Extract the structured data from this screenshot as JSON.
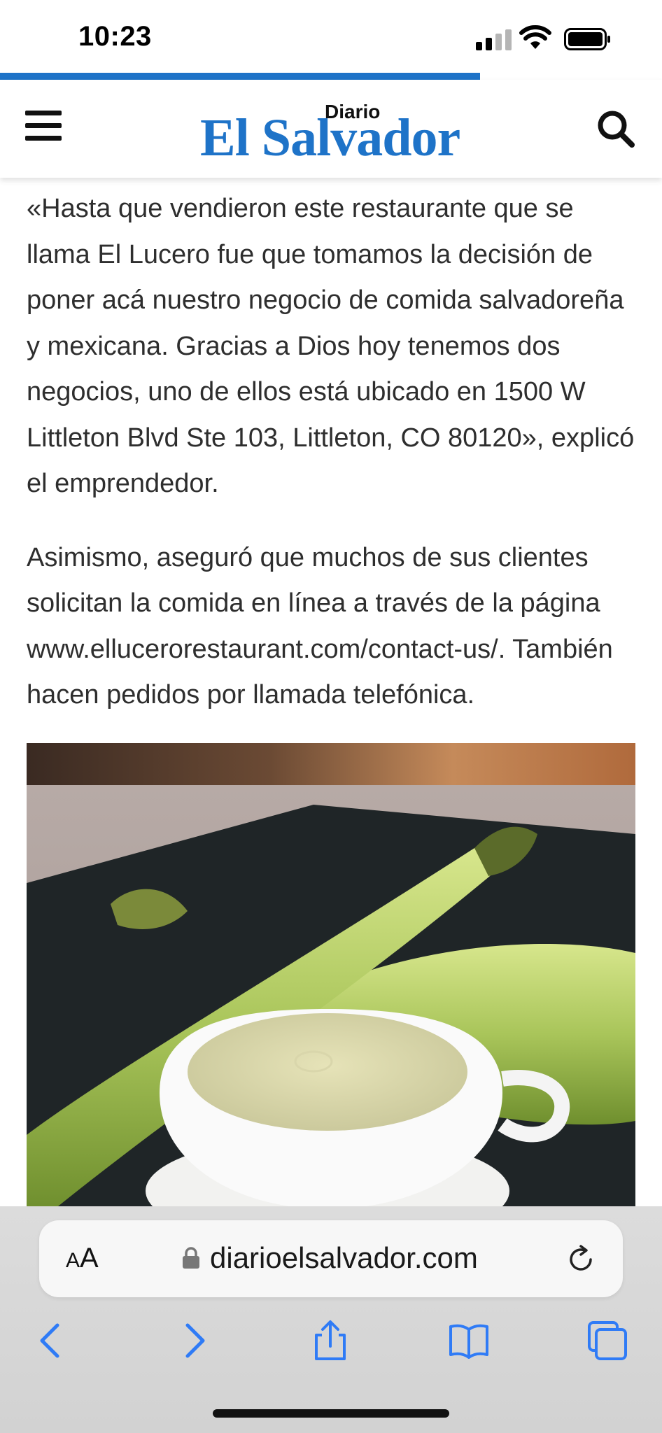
{
  "status_bar": {
    "time": "10:23"
  },
  "reading_progress": 0.725,
  "site": {
    "logo_main": "El Salvador",
    "logo_small": "Diario",
    "brand_color": "#1e73c8"
  },
  "article": {
    "paragraphs": [
      "«Hasta que vendieron este restaurante que se llama El Lucero fue que tomamos la decisión de poner acá nuestro negocio de comida salvadoreña y mexicana. Gracias a Dios hoy tenemos dos negocios, uno de ellos está ubicado en 1500 W Littleton Blvd Ste 103, Littleton, CO 80120», explicó el emprendedor.",
      "Asimismo, aseguró que muchos de sus clientes solicitan la comida en línea a través de la página www.ellucerorestaurant.com/contact-us/. También hacen pedidos por llamada telefónica."
    ]
  },
  "browser": {
    "aa_label_small": "A",
    "aa_label_large": "A",
    "url": "diarioelsalvador.com",
    "toolbar_icons": [
      "back-icon",
      "forward-icon",
      "share-icon",
      "bookmarks-icon",
      "tabs-icon"
    ],
    "accent_color": "#2f7bf6"
  }
}
